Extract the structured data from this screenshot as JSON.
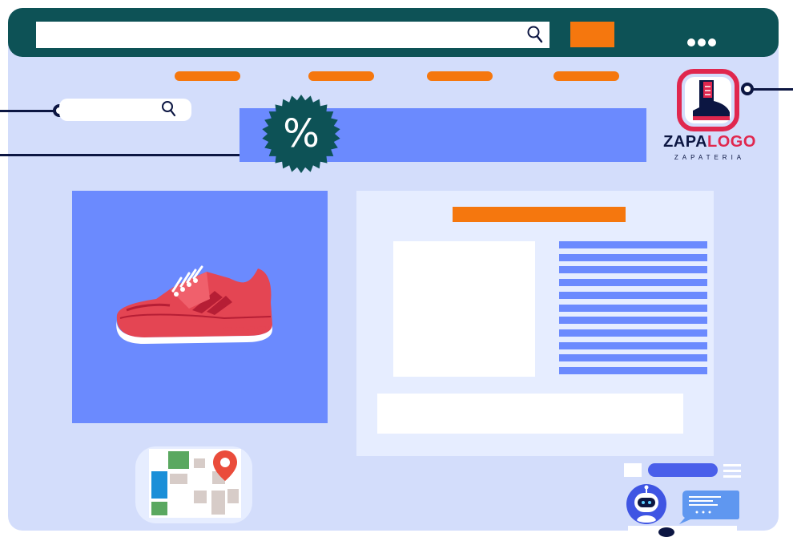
{
  "promo": {
    "badge_text": "%"
  },
  "logo": {
    "name_part1": "ZAPA",
    "name_part2": "LOGO",
    "tagline": "ZAPATERIA"
  },
  "search": {
    "value": "",
    "placeholder": ""
  },
  "colors": {
    "topbar": "#0d5256",
    "accent": "#f5770e",
    "panel_blue": "#6b8afe",
    "window_bg": "#d3ddfb",
    "dark_navy": "#0c1642",
    "logo_red": "#e0274e"
  },
  "icons": {
    "search": "magnifier-icon",
    "more": "three-dots-icon",
    "badge": "percent-badge-icon",
    "map": "map-pin-icon",
    "menu": "hamburger-icon",
    "bot": "robot-icon",
    "chat": "chat-bubble-icon"
  }
}
